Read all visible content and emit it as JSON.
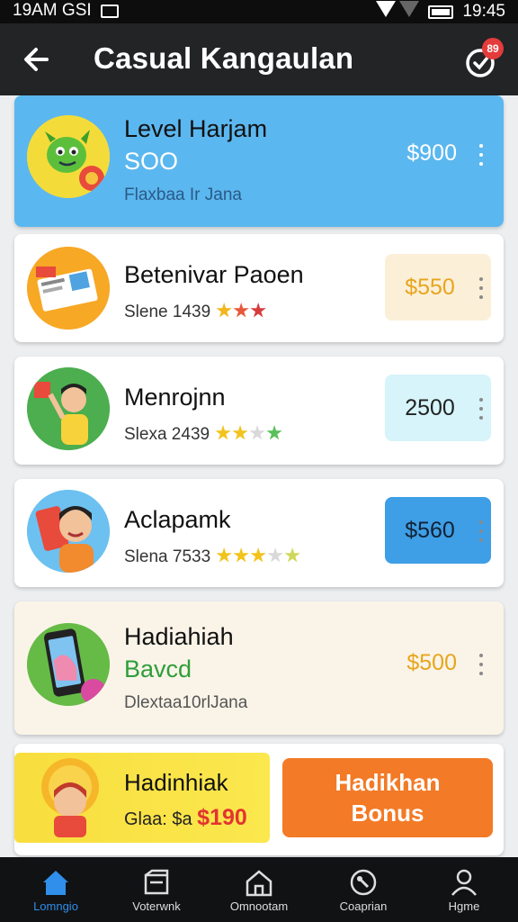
{
  "status_bar": {
    "left_text": "19AM GSI",
    "time": "19:45",
    "icons": [
      "message-icon",
      "wifi-icon",
      "signal-icon",
      "battery-icon"
    ]
  },
  "header": {
    "title": "Casual Kangaulan",
    "notification_count": "89"
  },
  "cards": [
    {
      "name": "Level Harjam",
      "sub": "SOO",
      "meta": "Flaxbaa Ir Jana",
      "price": "$900",
      "stars": []
    },
    {
      "name": "Betenivar Paoen",
      "meta": "Slene 1439",
      "price": "$550",
      "stars": [
        "#f2b51b",
        "#e8583c",
        "#d63c3c"
      ]
    },
    {
      "name": "Menrojnn",
      "meta": "Slexa 2439",
      "price": "2500",
      "stars": [
        "#f2c31b",
        "#f2c31b",
        "#d9d9d9",
        "#59c05a"
      ]
    },
    {
      "name": "Aclapamk",
      "meta": "Slena 7533",
      "price": "$560",
      "stars": [
        "#f2c31b",
        "#f2c31b",
        "#f2c31b",
        "#d9d9d9",
        "#cfd85a"
      ]
    },
    {
      "name": "Hadiahiah",
      "sub": "Bavcd",
      "meta": "Dlextaa10rlJana",
      "price": "$500",
      "stars": []
    }
  ],
  "bonus": {
    "title": "Hadinhiak",
    "meta_label": "Glaa: $a",
    "amount": "$190",
    "button_line1": "Hadikhan",
    "button_line2": "Bonus"
  },
  "nav": [
    {
      "label": "Lomngio",
      "icon": "home-icon",
      "active": true
    },
    {
      "label": "Voterwnk",
      "icon": "box-icon",
      "active": false
    },
    {
      "label": "Omnootam",
      "icon": "house-icon",
      "active": false
    },
    {
      "label": "Coaprian",
      "icon": "compass-icon",
      "active": false
    },
    {
      "label": "Hgme",
      "icon": "person-icon",
      "active": false
    }
  ],
  "colors": {
    "header_bg": "#222426",
    "highlight_card": "#5bb7ef",
    "price_orange": "#e8a51d",
    "green_text": "#2e9e3a",
    "bonus_red": "#e3342f",
    "bonus_button": "#f37a26",
    "nav_active": "#2f8fea"
  }
}
